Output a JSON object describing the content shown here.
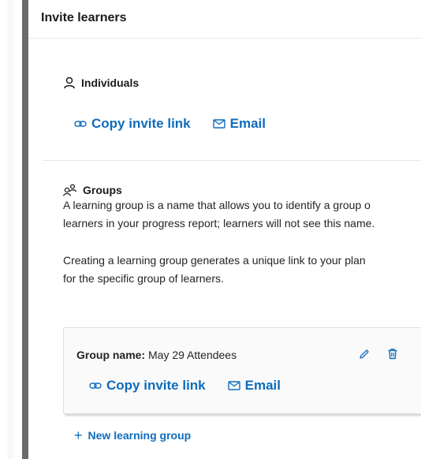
{
  "panel": {
    "title": "Invite learners"
  },
  "individuals": {
    "heading": "Individuals",
    "copy_invite_link": "Copy invite link",
    "email": "Email"
  },
  "groups": {
    "heading": "Groups",
    "description_line1": "A learning group is a name that allows you to identify a group o",
    "description_line2": "learners in your progress report; learners will not see this name.",
    "info_line1": "Creating a learning group generates a unique link to your plan",
    "info_line2": "for the specific group of learners.",
    "card": {
      "name_label": "Group name:",
      "name_value": " May 29 Attendees",
      "copy_invite_link": "Copy invite link",
      "email": "Email"
    },
    "new_group_label": "New learning group"
  },
  "colors": {
    "accent": "#0f6cbd",
    "rail": "#6b6b6b",
    "text": "#1b1b1b"
  },
  "icons": [
    "person-icon",
    "link-icon",
    "mail-icon",
    "people-icon",
    "pencil-icon",
    "trash-icon",
    "plus-icon"
  ]
}
